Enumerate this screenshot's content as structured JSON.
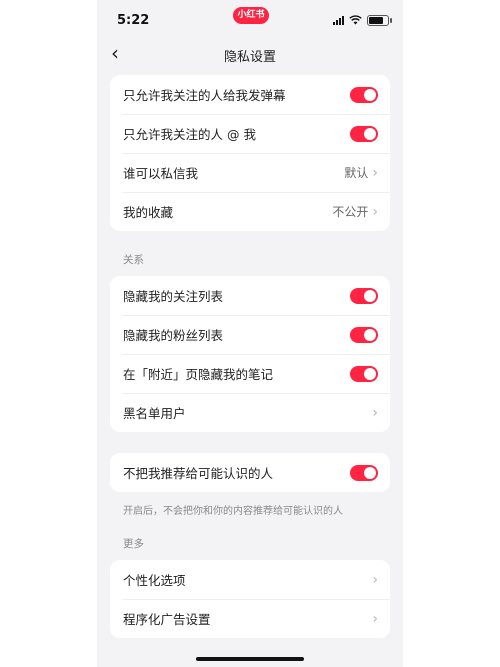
{
  "status": {
    "time": "5:22",
    "app_badge": "小红书"
  },
  "nav": {
    "title": "隐私设置"
  },
  "group1": [
    {
      "label": "只允许我关注的人给我发弹幕",
      "toggle": true
    },
    {
      "label": "只允许我关注的人 @ 我",
      "toggle": true
    },
    {
      "label": "谁可以私信我",
      "value": "默认"
    },
    {
      "label": "我的收藏",
      "value": "不公开"
    }
  ],
  "relations": {
    "section_label": "关系",
    "items": [
      {
        "label": "隐藏我的关注列表",
        "toggle": true
      },
      {
        "label": "隐藏我的粉丝列表",
        "toggle": true
      },
      {
        "label": "在「附近」页隐藏我的笔记",
        "toggle": true
      },
      {
        "label": "黑名单用户"
      }
    ]
  },
  "recommend": {
    "label": "不把我推荐给可能认识的人",
    "toggle": true,
    "note": "开启后，不会把你和你的内容推荐给可能认识的人"
  },
  "more": {
    "section_label": "更多",
    "items": [
      {
        "label": "个性化选项"
      },
      {
        "label": "程序化广告设置"
      }
    ]
  },
  "colors": {
    "accent": "#ff2442",
    "background": "#f3f3f5"
  }
}
